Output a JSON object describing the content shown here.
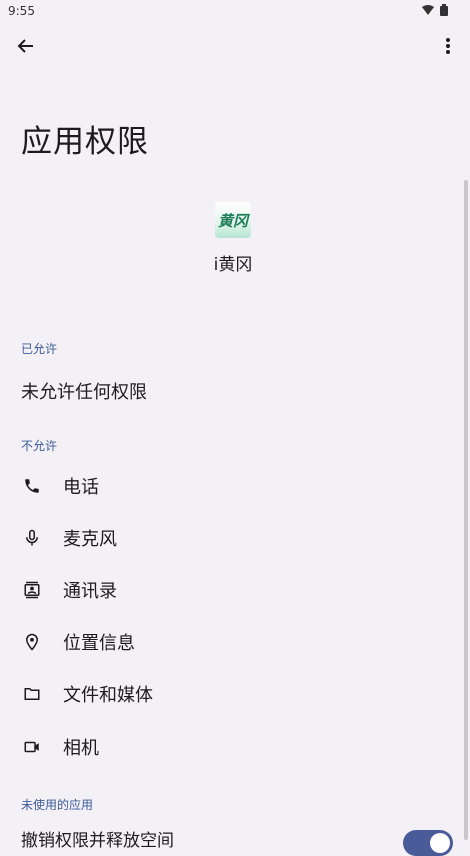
{
  "status": {
    "time": "9:55"
  },
  "page": {
    "title": "应用权限"
  },
  "app": {
    "name": "i黄冈",
    "icon_text": "黄冈"
  },
  "allowed": {
    "header": "已允许",
    "empty_text": "未允许任何权限"
  },
  "denied": {
    "header": "不允许",
    "items": [
      {
        "label": "电话",
        "icon": "phone-icon"
      },
      {
        "label": "麦克风",
        "icon": "microphone-icon"
      },
      {
        "label": "通讯录",
        "icon": "contacts-icon"
      },
      {
        "label": "位置信息",
        "icon": "location-icon"
      },
      {
        "label": "文件和媒体",
        "icon": "folder-icon"
      },
      {
        "label": "相机",
        "icon": "camera-icon"
      }
    ]
  },
  "unused": {
    "header": "未使用的应用",
    "toggle_label": "撤销权限并释放空间",
    "toggle_on": true
  },
  "colors": {
    "accent": "#3c5a9a",
    "background": "#f3f1f6",
    "toggle": "#4a5b9a"
  }
}
